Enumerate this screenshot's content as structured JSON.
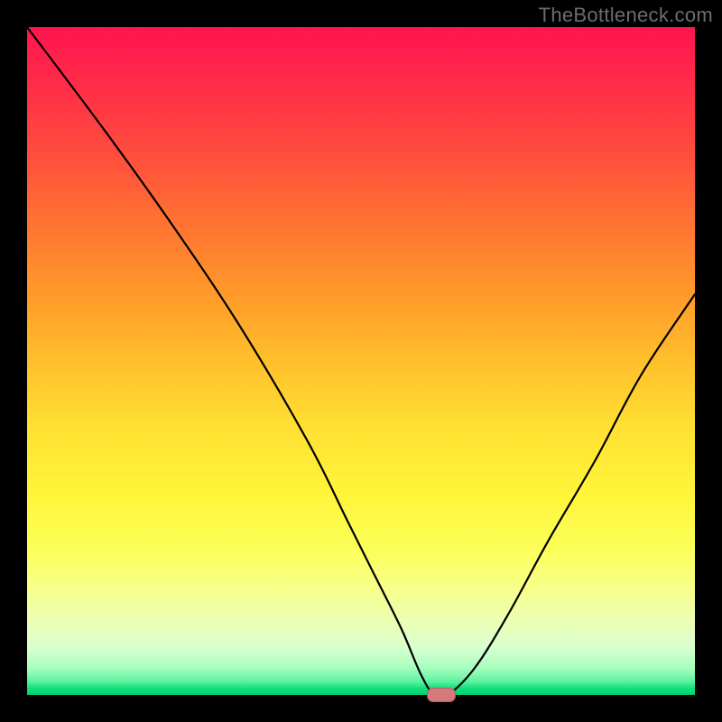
{
  "watermark": "TheBottleneck.com",
  "chart_data": {
    "type": "line",
    "title": "",
    "xlabel": "",
    "ylabel": "",
    "xlim": [
      0,
      100
    ],
    "ylim": [
      0,
      100
    ],
    "grid": false,
    "legend": false,
    "series": [
      {
        "name": "bottleneck-curve",
        "x": [
          0,
          12,
          22,
          32,
          42,
          48,
          52,
          56,
          59,
          61,
          63,
          67,
          72,
          78,
          85,
          92,
          100
        ],
        "values": [
          100,
          84,
          70,
          55,
          38,
          26,
          18,
          10,
          3,
          0,
          0,
          4,
          12,
          23,
          35,
          48,
          60
        ]
      }
    ],
    "marker": {
      "x": 62,
      "y": 0
    },
    "gradient_stops": [
      {
        "pos": 0,
        "color": "#ff1450"
      },
      {
        "pos": 50,
        "color": "#ffbf2c"
      },
      {
        "pos": 80,
        "color": "#fcff58"
      },
      {
        "pos": 100,
        "color": "#00cf6c"
      }
    ]
  }
}
